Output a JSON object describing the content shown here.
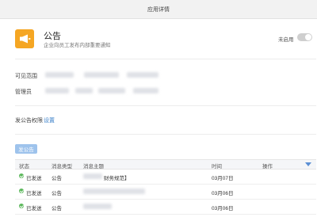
{
  "header": {
    "title": "应用详情"
  },
  "app": {
    "name": "公告",
    "description": "企业向员工发布内部重要通知",
    "icon": "megaphone-icon",
    "icon_color": "#f5a623",
    "toggle_label": "未启用",
    "enabled": false
  },
  "visible_range": {
    "label": "可见范围"
  },
  "admins": {
    "label": "管理员"
  },
  "publish_permission": {
    "label": "发公告权限",
    "action": "设置"
  },
  "publish_button": {
    "label": "发公告"
  },
  "table": {
    "columns": [
      "状态",
      "消息类型",
      "消息主题",
      "时间",
      "操作"
    ],
    "rows": [
      {
        "status": "已发送",
        "type": "公告",
        "subject": "财务规范】",
        "time": "03月07日"
      },
      {
        "status": "已发送",
        "type": "公告",
        "subject": "",
        "time": "03月06日"
      },
      {
        "status": "已发送",
        "type": "公告",
        "subject": "",
        "time": "03月06日"
      }
    ]
  },
  "colors": {
    "status_sent": "#5cb85c",
    "link": "#3b80c9",
    "primary_button": "#9ec3ec"
  }
}
